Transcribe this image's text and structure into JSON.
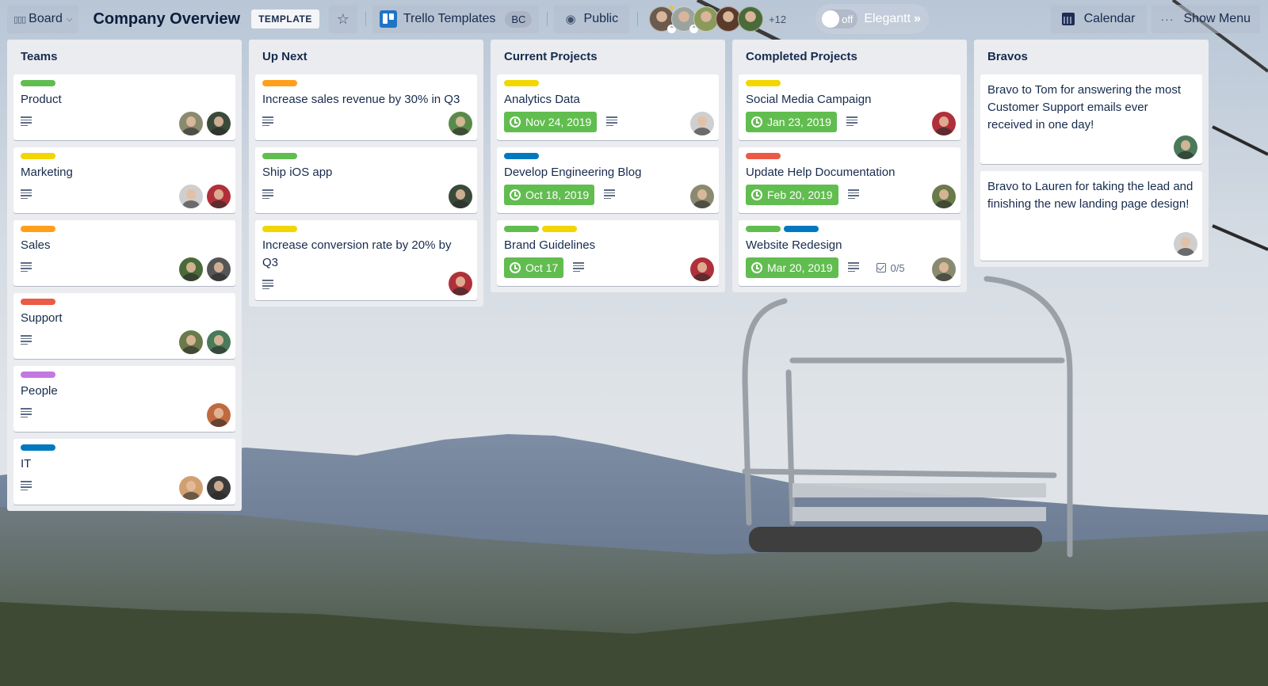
{
  "header": {
    "board_switcher": "Board",
    "board_title": "Company Overview",
    "template_badge": "TEMPLATE",
    "team_name": "Trello Templates",
    "team_badge": "BC",
    "visibility": "Public",
    "members_more": "+12",
    "powerup_toggle_state": "off",
    "powerup_name": "Elegantt",
    "calendar_label": "Calendar",
    "show_menu_label": "Show Menu",
    "members": [
      {
        "name": "member-1",
        "color": "#6b5a4e",
        "admin": true
      },
      {
        "name": "member-2",
        "color": "#9aa3a0",
        "admin": false
      },
      {
        "name": "member-3",
        "color": "#8a9a5a",
        "admin": false
      },
      {
        "name": "member-4",
        "color": "#5a3a2a",
        "admin": false
      },
      {
        "name": "member-5",
        "color": "#4a6a3a",
        "admin": false
      }
    ]
  },
  "colors": {
    "green": "#61bd4f",
    "yellow": "#f2d600",
    "orange": "#ff9f1a",
    "red": "#eb5a46",
    "purple": "#c377e0",
    "blue": "#0079bf",
    "due_badge": "#61bd4f"
  },
  "lists": [
    {
      "title": "Teams",
      "cards": [
        {
          "title": "Product",
          "labels": [
            "green"
          ],
          "description": true,
          "avatars": [
            "#8a8a70",
            "#3a4a3a"
          ]
        },
        {
          "title": "Marketing",
          "labels": [
            "yellow"
          ],
          "description": true,
          "avatars": [
            "#cfcfcf",
            "#b0303a"
          ]
        },
        {
          "title": "Sales",
          "labels": [
            "orange"
          ],
          "description": true,
          "avatars": [
            "#4a6a3a",
            "#555555"
          ]
        },
        {
          "title": "Support",
          "labels": [
            "red"
          ],
          "description": true,
          "avatars": [
            "#6a7a4a",
            "#4a7a5a"
          ]
        },
        {
          "title": "People",
          "labels": [
            "purple"
          ],
          "description": true,
          "avatars": [
            "#c06a40"
          ]
        },
        {
          "title": "IT",
          "labels": [
            "blue"
          ],
          "description": true,
          "avatars": [
            "#d0a070",
            "#3a3a3a"
          ]
        }
      ]
    },
    {
      "title": "Up Next",
      "cards": [
        {
          "title": "Increase sales revenue by 30% in Q3",
          "labels": [
            "orange"
          ],
          "description": true,
          "avatars": [
            "#5a8a4a"
          ]
        },
        {
          "title": "Ship iOS app",
          "labels": [
            "green"
          ],
          "description": true,
          "avatars": [
            "#3a4a3a"
          ]
        },
        {
          "title": "Increase conversion rate by 20% by Q3",
          "labels": [
            "yellow"
          ],
          "description": true,
          "avatars": [
            "#b0303a"
          ]
        }
      ]
    },
    {
      "title": "Current Projects",
      "cards": [
        {
          "title": "Analytics Data",
          "labels": [
            "yellow"
          ],
          "due": "Nov 24, 2019",
          "description": true,
          "avatars": [
            "#cfcfcf"
          ]
        },
        {
          "title": "Develop Engineering Blog",
          "labels": [
            "blue"
          ],
          "due": "Oct 18, 2019",
          "description": true,
          "avatars": [
            "#8a8a70"
          ]
        },
        {
          "title": "Brand Guidelines",
          "labels": [
            "green",
            "yellow"
          ],
          "due": "Oct 17",
          "description": true,
          "avatars": [
            "#b0303a"
          ]
        }
      ]
    },
    {
      "title": "Completed Projects",
      "cards": [
        {
          "title": "Social Media Campaign",
          "labels": [
            "yellow"
          ],
          "due": "Jan 23, 2019",
          "description": true,
          "avatars": [
            "#b0303a"
          ]
        },
        {
          "title": "Update Help Documentation",
          "labels": [
            "red"
          ],
          "due": "Feb 20, 2019",
          "description": true,
          "avatars": [
            "#6a7a4a"
          ]
        },
        {
          "title": "Website Redesign",
          "labels": [
            "green",
            "blue"
          ],
          "due": "Mar 20, 2019",
          "description": true,
          "checklist": "0/5",
          "avatars": [
            "#8a8a70"
          ]
        }
      ]
    },
    {
      "title": "Bravos",
      "cards": [
        {
          "title": "Bravo to Tom for answering the most Customer Support emails ever received in one day!",
          "labels": [],
          "description": false,
          "avatars": [
            "#4a7a5a"
          ]
        },
        {
          "title": "Bravo to Lauren for taking the lead and finishing the new landing page design!",
          "labels": [],
          "description": false,
          "avatars": [
            "#cfcfcf"
          ]
        }
      ]
    }
  ]
}
